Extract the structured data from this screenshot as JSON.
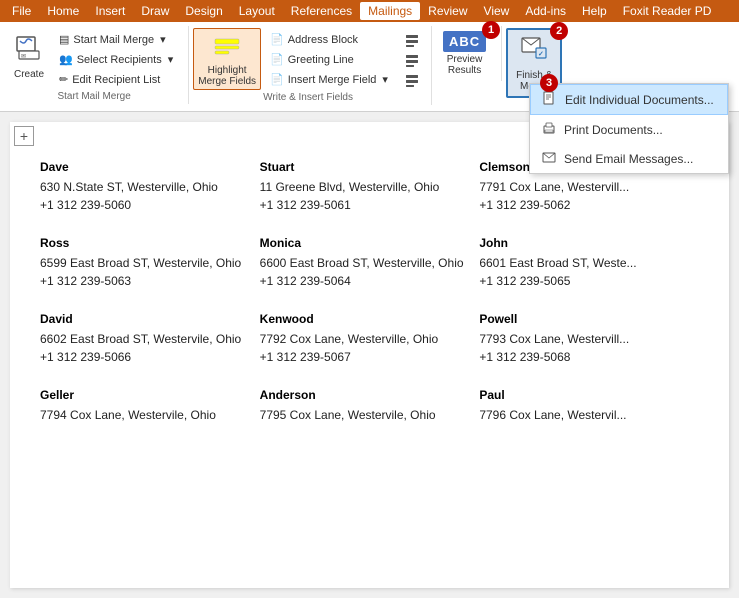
{
  "menu": {
    "items": [
      "File",
      "Home",
      "Insert",
      "Draw",
      "Design",
      "Layout",
      "References",
      "Mailings",
      "Review",
      "View",
      "Add-ins",
      "Help",
      "Foxit Reader PD"
    ]
  },
  "ribbon": {
    "groups": [
      {
        "label": "Start Mail Merge",
        "buttons": [
          {
            "id": "create",
            "icon": "✉",
            "label": "Create",
            "large": true
          }
        ],
        "small_buttons": [
          {
            "id": "start-mail-merge",
            "icon": "▤",
            "label": "Start Mail Merge",
            "arrow": true
          },
          {
            "id": "select-recipients",
            "icon": "👥",
            "label": "Select Recipients",
            "arrow": true
          },
          {
            "id": "edit-recipient-list",
            "icon": "✏",
            "label": "Edit Recipient List"
          }
        ]
      },
      {
        "label": "Write & Insert Fields",
        "buttons": [
          {
            "id": "highlight-merge-fields",
            "icon": "🔆",
            "label": "Highlight\nMerge Fields",
            "large": false
          }
        ],
        "small_buttons": [
          {
            "id": "address-block",
            "icon": "📄",
            "label": "Address Block"
          },
          {
            "id": "greeting-line",
            "icon": "📄",
            "label": "Greeting Line"
          },
          {
            "id": "insert-merge-field",
            "icon": "📄",
            "label": "Insert Merge Field",
            "arrow": true
          }
        ]
      },
      {
        "label": "",
        "buttons": [
          {
            "id": "preview-results",
            "icon": "ABC",
            "label": "Preview\nResults"
          }
        ]
      },
      {
        "label": "",
        "buttons": [
          {
            "id": "finish-merge",
            "icon": "🏁",
            "label": "Finish &\nMerge"
          }
        ]
      }
    ],
    "badge1": "1",
    "badge2": "2",
    "badge3": "3"
  },
  "dropdown": {
    "items": [
      {
        "id": "edit-individual",
        "icon": "📄",
        "label": "Edit Individual Documents...",
        "selected": true
      },
      {
        "id": "print-documents",
        "icon": "🖨",
        "label": "Print Documents..."
      },
      {
        "id": "send-email",
        "icon": "✉",
        "label": "Send Email Messages..."
      }
    ]
  },
  "document": {
    "contacts": [
      {
        "name": "Dave",
        "address": "630 N.State ST, Westerville, Ohio",
        "phone": "+1 312 239-5060"
      },
      {
        "name": "Stuart",
        "address": "11 Greene Blvd, Westerville, Ohio",
        "phone": "+1 312 239-5061"
      },
      {
        "name": "Clemson",
        "address": "7791 Cox Lane, Westervill...",
        "phone": "+1 312 239-5062"
      },
      {
        "name": "Ross",
        "address": "6599 East Broad ST, Westervile, Ohio",
        "phone": "+1 312 239-5063"
      },
      {
        "name": "Monica",
        "address": "6600 East Broad ST, Westerville, Ohio",
        "phone": "+1 312 239-5064"
      },
      {
        "name": "John",
        "address": "6601 East Broad ST, Weste...",
        "phone": "+1 312 239-5065"
      },
      {
        "name": "David",
        "address": "6602 East Broad ST, Westervile, Ohio",
        "phone": "+1 312 239-5066"
      },
      {
        "name": "Kenwood",
        "address": "7792 Cox Lane, Westerville, Ohio",
        "phone": "+1 312 239-5067"
      },
      {
        "name": "Powell",
        "address": "7793 Cox Lane, Westervill...",
        "phone": "+1 312 239-5068"
      },
      {
        "name": "Geller",
        "address": "7794 Cox Lane, Westervile, Ohio",
        "phone": ""
      },
      {
        "name": "Anderson",
        "address": "7795 Cox Lane, Westervile, Ohio",
        "phone": ""
      },
      {
        "name": "Paul",
        "address": "7796 Cox Lane, Westervil...",
        "phone": ""
      }
    ]
  },
  "labels": {
    "file": "File",
    "mailings_tab": "Mailings",
    "start_mail_merge": "Start Mail Merge",
    "select_recipients": "Select Recipients",
    "edit_recipient_list": "Edit Recipient List",
    "highlight_merge_fields": "Highlight\nMerge Fields",
    "address_block": "Address Block",
    "greeting_line": "Greeting Line",
    "insert_merge_field": "Insert Merge Field",
    "preview_results": "Preview\nResults",
    "finish_and_merge": "Finish &\nMerge",
    "write_insert_fields": "Write & Insert Fields",
    "start_mail_merge_group": "Start Mail Merge",
    "edit_individual": "Edit Individual Documents...",
    "print_documents": "Print Documents...",
    "send_email": "Send Email Messages..."
  }
}
